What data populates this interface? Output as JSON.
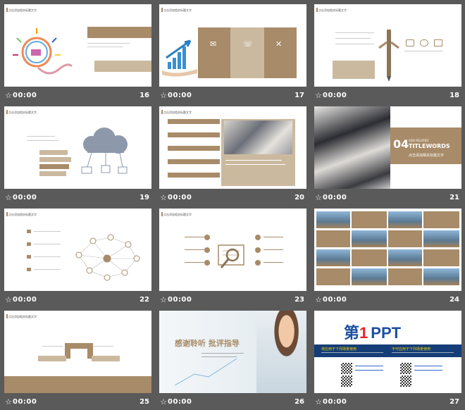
{
  "slides": [
    {
      "number": "16",
      "time": "00:00",
      "star": "☆"
    },
    {
      "number": "17",
      "time": "00:00",
      "star": "☆"
    },
    {
      "number": "18",
      "time": "00:00",
      "star": "☆"
    },
    {
      "number": "19",
      "time": "00:00",
      "star": "☆"
    },
    {
      "number": "20",
      "time": "00:00",
      "star": "☆"
    },
    {
      "number": "21",
      "time": "00:00",
      "star": "☆"
    },
    {
      "number": "22",
      "time": "00:00",
      "star": "☆"
    },
    {
      "number": "23",
      "time": "00:00",
      "star": "☆"
    },
    {
      "number": "24",
      "time": "00:00",
      "star": "☆"
    },
    {
      "number": "25",
      "time": "00:00",
      "star": "☆"
    },
    {
      "number": "26",
      "time": "00:00",
      "star": "☆"
    },
    {
      "number": "27",
      "time": "00:00",
      "star": "☆"
    }
  ],
  "slide21": {
    "big_num": "04",
    "small": "ADD RELATED",
    "title": "TITLEWORDS",
    "subtitle": "点击添加相关标题文字"
  },
  "slide26": {
    "thanks": "感谢聆听 批评指导"
  },
  "slide27": {
    "logo_main": "第",
    "logo_num": "1",
    "logo_ppt": "PPT",
    "col1": "将应用于下列场景使用",
    "col2": "不可应用于下列场景使用"
  },
  "colors": {
    "background": "#5a5a5a",
    "accent": "#a88b68",
    "accent_light": "#cbb99f"
  }
}
